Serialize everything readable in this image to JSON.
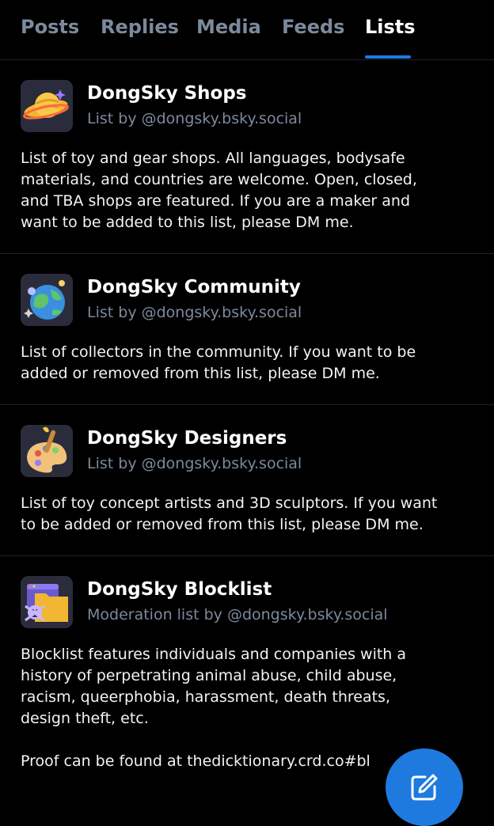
{
  "tabs": [
    {
      "label": "Posts"
    },
    {
      "label": "Replies"
    },
    {
      "label": "Media"
    },
    {
      "label": "Feeds"
    },
    {
      "label": "Lists"
    }
  ],
  "lists": [
    {
      "title": "DongSky Shops",
      "subtitle": "List by @dongsky.bsky.social",
      "avatar_icon": "planet-icon",
      "description": [
        "List of toy and gear shops. All languages, bodysafe",
        "materials, and countries are welcome. Open, closed,",
        "and TBA shops are featured. If you are a maker and",
        "want to be added to this list, please DM me."
      ]
    },
    {
      "title": "DongSky Community",
      "subtitle": "List by @dongsky.bsky.social",
      "avatar_icon": "globe-icon",
      "description": [
        "List of collectors in the community. If you want to be",
        "added or removed from this list, please DM me."
      ]
    },
    {
      "title": "DongSky Designers",
      "subtitle": "List by @dongsky.bsky.social",
      "avatar_icon": "palette-icon",
      "description": [
        "List of toy concept artists and 3D sculptors. If you want",
        "to be added or removed from this list, please DM me."
      ]
    },
    {
      "title": "DongSky Blocklist",
      "subtitle": "Moderation list by @dongsky.bsky.social",
      "avatar_icon": "skull-folder-icon",
      "description": [
        "Blocklist features individuals and companies with a",
        "history of perpetrating animal abuse, child abuse,",
        "racism, queerphobia, harassment, death threats,",
        "design theft, etc."
      ],
      "description_more": "Proof can be found at thedicktionary.crd.co#bl"
    }
  ],
  "fab": {
    "icon": "compose-icon"
  },
  "colors": {
    "background": "#000000",
    "accent": "#1f7ae0",
    "muted_text": "#7b8a9c",
    "divider": "#1c232c"
  }
}
